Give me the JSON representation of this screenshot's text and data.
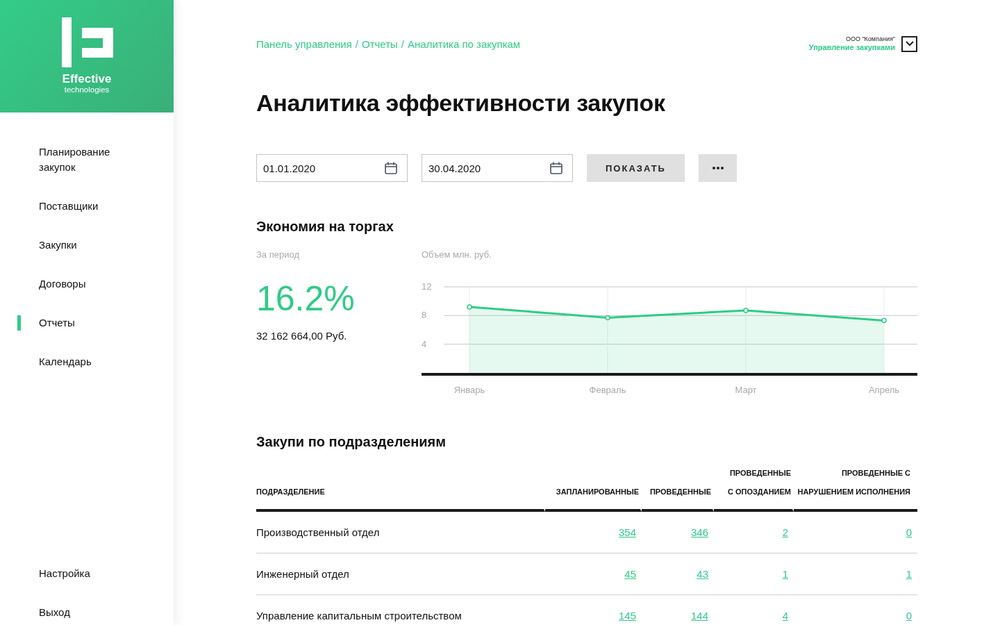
{
  "logo": {
    "name": "Effective",
    "tagline": "technologies"
  },
  "sidebar": {
    "items": [
      {
        "label": "Планирование закупок",
        "selected": false
      },
      {
        "label": "Поставщики",
        "selected": false
      },
      {
        "label": "Закупки",
        "selected": false
      },
      {
        "label": "Договоры",
        "selected": false
      },
      {
        "label": "Отчеты",
        "selected": true
      },
      {
        "label": "Календарь",
        "selected": false
      }
    ],
    "bottom_items": [
      {
        "label": "Настройка"
      },
      {
        "label": "Выход"
      }
    ]
  },
  "breadcrumb": {
    "separator": "/",
    "items": [
      "Панель управления",
      "Отчеты",
      "Аналитика по закупкам"
    ]
  },
  "account": {
    "company": "ООО \"Компания\"",
    "role": "Управление закупками"
  },
  "title": "Аналитика эффективности закупок",
  "filters": {
    "date_from": "01.01.2020",
    "date_to": "30.04.2020",
    "show_button": "ПОКАЗАТЬ"
  },
  "savings": {
    "title": "Экономия на торгах",
    "period_label": "За период",
    "percent": "16.2%",
    "amount": "32 162 664,00 Руб.",
    "chart_data": {
      "type": "area",
      "ylabel": "Объем млн. руб.",
      "categories": [
        "Январь",
        "Февраль",
        "Март",
        "Апрель"
      ],
      "series": [
        {
          "color": "#2ecc85",
          "values": [
            9.2,
            7.7,
            8.7,
            7.3
          ]
        }
      ],
      "grid": true,
      "ylim": [
        0,
        12
      ],
      "yticks": [
        4,
        8,
        12
      ]
    }
  },
  "departments": {
    "title": "Закупи по подразделениям",
    "columns": [
      "ПОДРАЗДЕЛЕНИЕ",
      "ЗАПЛАНИРОВАННЫЕ",
      "ПРОВЕДЕННЫЕ",
      "ПРОВЕДЕННЫЕ С ОПОЗДАНИЕМ",
      "ПРОВЕДЕННЫЕ С НАРУШЕНИЕМ ИСПОЛНЕНИЯ"
    ],
    "rows": [
      {
        "name": "Производственный отдел",
        "values": [
          "354",
          "346",
          "2",
          "0"
        ]
      },
      {
        "name": "Инженерный отдел",
        "values": [
          "45",
          "43",
          "1",
          "1"
        ]
      },
      {
        "name": "Управление капитальным строительством",
        "values": [
          "145",
          "144",
          "4",
          "0"
        ]
      }
    ]
  }
}
